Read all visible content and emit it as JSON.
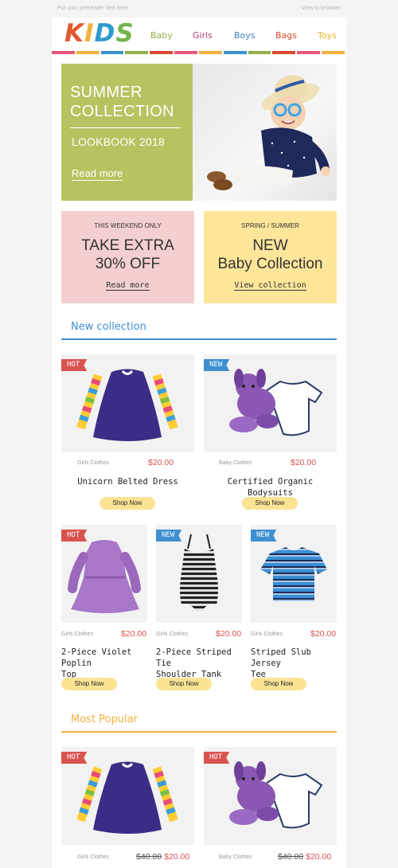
{
  "preheader": {
    "left": "Put your preheader text here",
    "right": "View in browser"
  },
  "header": {
    "logo": [
      "K",
      "I",
      "D",
      "S"
    ],
    "logo_colors": [
      "#e2572f",
      "#f2b13f",
      "#2e9bd0",
      "#71b54a"
    ],
    "nav": [
      {
        "label": "Baby",
        "color": "#8fb147"
      },
      {
        "label": "Girls",
        "color": "#b2447a"
      },
      {
        "label": "Boys",
        "color": "#3d7fc1"
      },
      {
        "label": "Bags",
        "color": "#d9492c"
      },
      {
        "label": "Toys",
        "color": "#e4b62c"
      }
    ],
    "stripe_colors": [
      "#e8567a",
      "#f2b13f",
      "#3d8fd0",
      "#8fb147",
      "#d9492c",
      "#e8567a",
      "#f2b13f",
      "#3d8fd0"
    ]
  },
  "hero": {
    "title_line1": "SUMMER",
    "title_line2": "COLLECTION",
    "subtitle": "LOOKBOOK 2018",
    "cta": "Read more",
    "bg_color": "#b7c360"
  },
  "promos": [
    {
      "kicker": "THIS WEEKEND ONLY",
      "line1": "TAKE EXTRA",
      "line2": "30% OFF",
      "cta": "Read more",
      "bg": "#f4cfcf"
    },
    {
      "kicker": "SPRING / SUMMER",
      "line1": "NEW",
      "line2": "Baby Collection",
      "cta": "View collection",
      "bg": "#fde59a"
    }
  ],
  "sections": {
    "new_collection": {
      "title": "New collection",
      "color": "#3d8fd0"
    },
    "most_popular": {
      "title": "Most Popular",
      "color": "#f2b13f"
    }
  },
  "new_collection_row1": [
    {
      "badge": "HOT",
      "badge_color": "#d9534f",
      "category": "Girls Clothes",
      "price": "$20.00",
      "name": "Unicorn Belted Dress",
      "cta": "Shop Now"
    },
    {
      "badge": "NEW",
      "badge_color": "#3d8fd0",
      "category": "Baby Clothes",
      "price": "$20.00",
      "name": "Certified Organic Bodysuits",
      "cta": "Shop Now"
    }
  ],
  "new_collection_row2": [
    {
      "badge": "HOT",
      "badge_color": "#d9534f",
      "category": "Girls Clothes",
      "price": "$20.00",
      "name_line1": "2-Piece Violet Poplin",
      "name_line2": "Top",
      "cta": "Shop Now"
    },
    {
      "badge": "NEW",
      "badge_color": "#3d8fd0",
      "category": "Girls Clothes",
      "price": "$20.00",
      "name_line1": "2-Piece Striped Tie",
      "name_line2": "Shoulder Tank",
      "cta": "Shop Now"
    },
    {
      "badge": "NEW",
      "badge_color": "#3d8fd0",
      "category": "Girls Clothes",
      "price": "$20.00",
      "name_line1": "Striped Slub Jersey",
      "name_line2": "Tee",
      "cta": "Shop Now"
    }
  ],
  "most_popular": [
    {
      "badge": "HOT",
      "badge_color": "#d9534f",
      "category": "Girls Clothes",
      "old_price": "$40.00",
      "price": "$20.00"
    },
    {
      "badge": "HOT",
      "badge_color": "#d9534f",
      "category": "Baby Clothes",
      "old_price": "$40.00",
      "price": "$20.00"
    }
  ]
}
